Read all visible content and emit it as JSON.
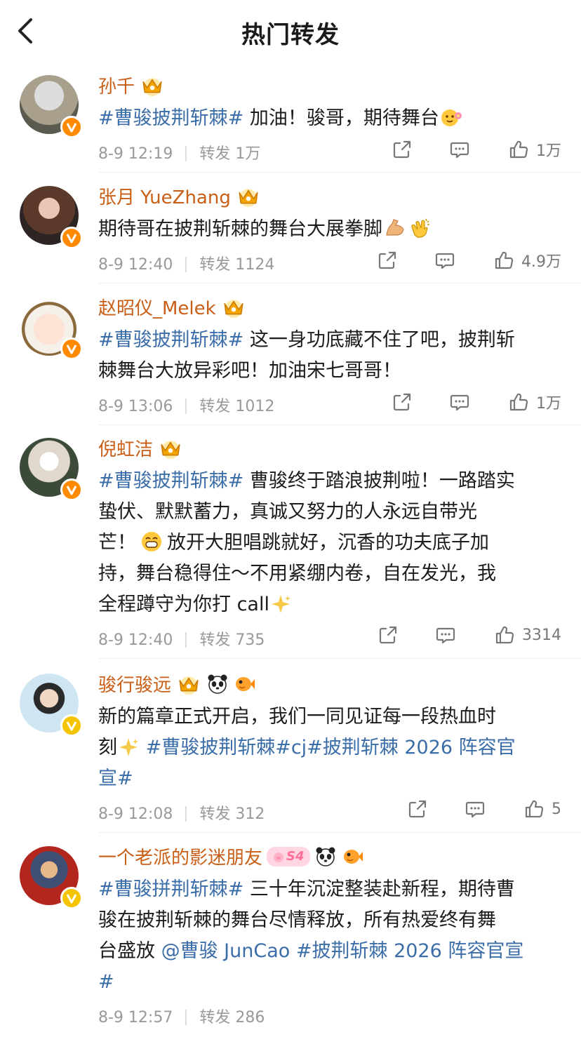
{
  "header": {
    "title": "热门转发"
  },
  "posts": [
    {
      "name": "孙千",
      "seg1": "#曹骏披荆斩棘#",
      "seg2": " 加油！骏哥，期待舞台",
      "time": "8-9 12:19",
      "repost": "转发 1万",
      "likes": "1万",
      "badge_color": "#ff8a00"
    },
    {
      "name": "张月 YueZhang",
      "seg1": "",
      "seg2": "期待哥在披荆斩棘的舞台大展拳脚",
      "time": "8-9 12:40",
      "repost": "转发 1124",
      "likes": "4.9万",
      "badge_color": "#ff8a00"
    },
    {
      "name": "赵昭仪_Melek",
      "seg1": "#曹骏披荆斩棘#",
      "seg2": " 这一身功底藏不住了吧，披荆斩",
      "line2": "棘舞台大放异彩吧！加油宋七哥哥！",
      "time": "8-9 13:06",
      "repost": "转发 1012",
      "likes": "1万",
      "badge_color": "#ff8a00"
    },
    {
      "name": "倪虹洁",
      "seg1": "#曹骏披荆斩棘#",
      "seg2": " 曹骏终于踏浪披荆啦！一路踏实",
      "line2": "蛰伏、默默蓄力，真诚又努力的人永远自带光",
      "line3a": "芒！",
      "line3b": "放开大胆唱跳就好，沉香的功夫底子加",
      "line4": "持，舞台稳得住～不用紧绷内卷，自在发光，我",
      "line5": "全程蹲守为你打 call",
      "time": "8-9 12:40",
      "repost": "转发 735",
      "likes": "3314",
      "badge_color": "#ff8a00"
    },
    {
      "name": "骏行骏远",
      "line1": "新的篇章正式开启，我们一同见证每一段热血时",
      "line2a": "刻",
      "line2b": " #曹骏披荆斩棘#cj#披荆斩棘 2026 阵容官",
      "line3": "宣#",
      "time": "8-9 12:08",
      "repost": "转发 312",
      "likes": "5",
      "badge_color": "#f5c400"
    },
    {
      "name": "一个老派的影迷朋友",
      "level": "S4",
      "seg1": "#曹骏拼荆斩棘#",
      "seg2": " 三十年沉淀整装赴新程，期待曹",
      "line2": "骏在披荆斩棘的舞台尽情释放，所有热爱终有舞",
      "line3a": "台盛放 ",
      "line3b": "@曹骏 JunCao #披荆斩棘 2026 阵容官宣",
      "line4": "#",
      "time": "8-9 12:57",
      "repost": "转发 286",
      "badge_color": "#f5c400"
    }
  ],
  "colors": {
    "username": "#c95e16",
    "topic": "#3b6ea8",
    "meta": "#999999"
  }
}
